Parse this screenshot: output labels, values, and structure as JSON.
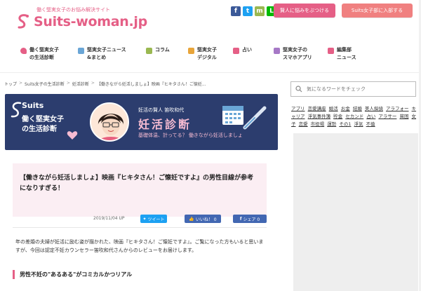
{
  "header": {
    "tagline": "働く堅実女子のお悩み解決サイト",
    "logo_text": "Suits-woman.jp",
    "social": [
      {
        "name": "facebook-icon",
        "glyph": "f",
        "color": "#3b5998"
      },
      {
        "name": "twitter-icon",
        "glyph": "t",
        "color": "#1da1f2"
      },
      {
        "name": "mail-icon",
        "glyph": "m",
        "color": "#9ab851"
      },
      {
        "name": "line-icon",
        "glyph": "L",
        "color": "#00b900"
      }
    ],
    "consult_button": "賢人に悩みをぶつける",
    "join_button": "Suits女子部に入部する",
    "consult_color": "#e55f86",
    "join_color": "#f08080"
  },
  "nav": {
    "items": [
      {
        "label": "働く堅実女子\nの生活診断",
        "icon": "heart-icon",
        "color": "#e55f86"
      },
      {
        "label": "堅実女子ニュース\n&まとめ",
        "icon": "tag-icon",
        "color": "#6aa6d6"
      },
      {
        "label": "コラム",
        "icon": "book-icon",
        "color": "#9ab851"
      },
      {
        "label": "堅実女子\nデジタル",
        "icon": "lock-icon",
        "color": "#e8a53a"
      },
      {
        "label": "占い",
        "icon": "star-icon",
        "color": "#e55f86"
      },
      {
        "label": "堅実女子の\nスマホアプリ",
        "icon": "smartphone-icon",
        "color": "#a678c6"
      },
      {
        "label": "編集部\nニュース",
        "icon": "news-icon",
        "color": "#e55f86"
      }
    ]
  },
  "breadcrumb": [
    "トップ",
    "Suits女子の生活診断",
    "妊活診断",
    "【働きながら妊活しましょ】映画『ヒキタさん！ご懐妊..."
  ],
  "banner": {
    "logo": "Suits",
    "title": "働く堅実女子\nの生活診断",
    "subtitle": "妊活の賢人 笛吹和代",
    "big_title": "妊活診断",
    "description": "基礎体温、計ってる？ 働きながら妊活しましょ"
  },
  "article": {
    "title": "【働きながら妊活しましょ】映画『ヒキタさん！ご懐妊ですよ』の男性目線が参考になりすぎる！",
    "date": "2019/11/04 UP",
    "tweet_label": "ツイート",
    "like_label": "いいね！ 0",
    "share_label": "シェア 0",
    "intro": "年の差婚の夫婦が妊活に励む姿が描かれた、映画『ヒキタさん！ご懐妊ですよ』。ご覧になった方もいると思いますが、今回は認定不妊カウンセラー笛吹和代さんからのレビューをお届けします。",
    "heading": "男性不妊の\"あるある\"がコミカルかつリアル"
  },
  "sidebar": {
    "search_placeholder": "気になるワードをチェック",
    "tags": [
      "アプリ",
      "恋愛講座",
      "婚活",
      "お金",
      "結婚",
      "美人探偵",
      "アラフォー",
      "キャリア",
      "浮気事件簿",
      "貯金",
      "セカンド",
      "占い",
      "アラサー",
      "貧困",
      "女子",
      "恋愛",
      "市役場",
      "運勢",
      "その1",
      "浮気",
      "不倫"
    ]
  }
}
